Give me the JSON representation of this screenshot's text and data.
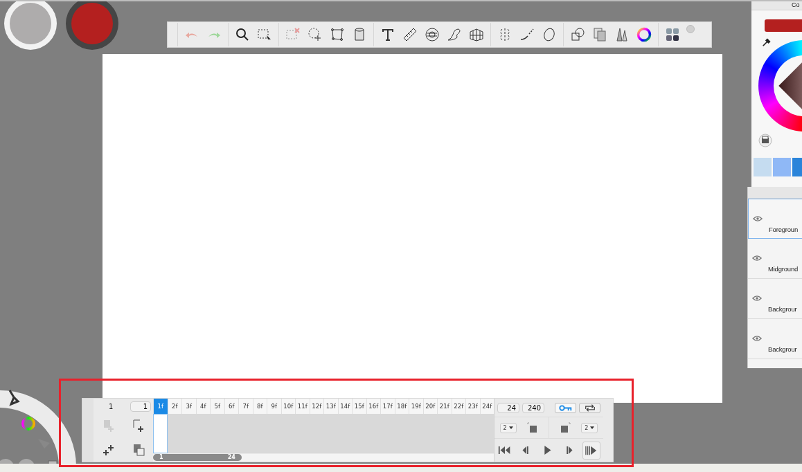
{
  "color_panel": {
    "title": "Co",
    "swatches": [
      {
        "color": "#c5dcf0"
      },
      {
        "color": "#8fb8f6"
      },
      {
        "color": "#2a84da"
      }
    ]
  },
  "layers": [
    {
      "name": "Foregroun",
      "selected": true,
      "visible": true
    },
    {
      "name": "Midground",
      "selected": false,
      "visible": true
    },
    {
      "name": "Backgrour",
      "selected": false,
      "visible": true
    },
    {
      "name": "Backgrour",
      "selected": false,
      "visible": true
    }
  ],
  "timeline": {
    "start_frame": "1",
    "current_frame": "1",
    "frames": [
      {
        "label": "1f",
        "selected": true
      },
      {
        "label": "2f",
        "selected": false
      },
      {
        "label": "3f",
        "selected": false
      },
      {
        "label": "4f",
        "selected": false
      },
      {
        "label": "5f",
        "selected": false
      },
      {
        "label": "6f",
        "selected": false
      },
      {
        "label": "7f",
        "selected": false
      },
      {
        "label": "8f",
        "selected": false
      },
      {
        "label": "9f",
        "selected": false
      },
      {
        "label": "10f",
        "selected": false
      },
      {
        "label": "11f",
        "selected": false
      },
      {
        "label": "12f",
        "selected": false
      },
      {
        "label": "13f",
        "selected": false
      },
      {
        "label": "14f",
        "selected": false
      },
      {
        "label": "15f",
        "selected": false
      },
      {
        "label": "16f",
        "selected": false
      },
      {
        "label": "17f",
        "selected": false
      },
      {
        "label": "18f",
        "selected": false
      },
      {
        "label": "19f",
        "selected": false
      },
      {
        "label": "20f",
        "selected": false
      },
      {
        "label": "21f",
        "selected": false
      },
      {
        "label": "22f",
        "selected": false
      },
      {
        "label": "23f",
        "selected": false
      },
      {
        "label": "24f",
        "selected": false
      }
    ],
    "fps": "24",
    "total_frames": "240",
    "range": {
      "start": "1",
      "end": "24",
      "level": 0.26
    },
    "onion_before": "2",
    "onion_after": "2",
    "keyframe_on": true,
    "loop_on": false
  }
}
